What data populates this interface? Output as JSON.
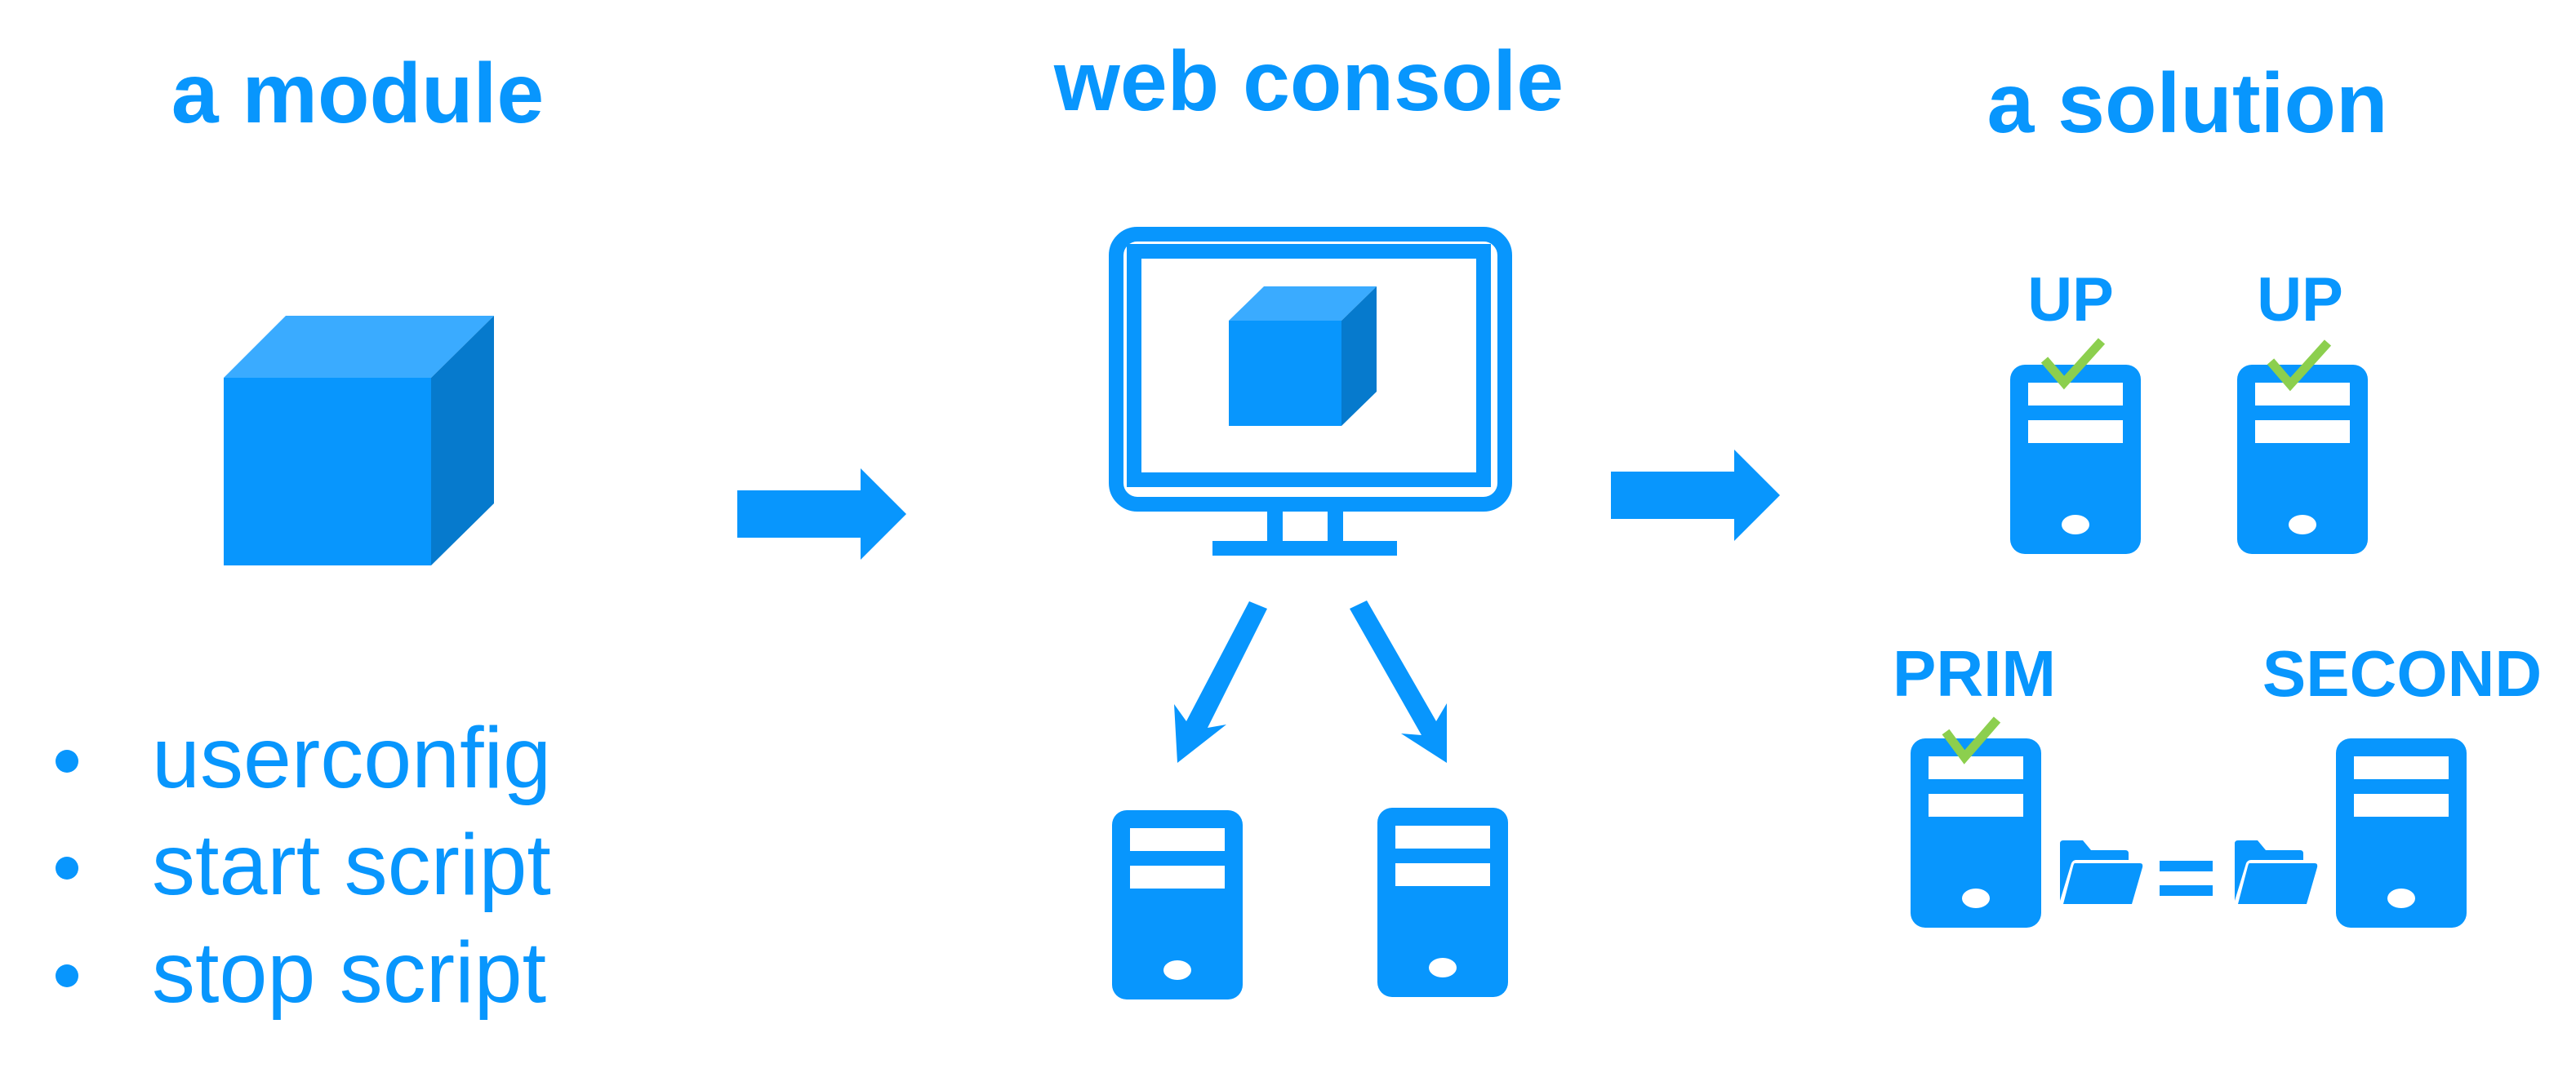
{
  "colors": {
    "primary": "#0896fd",
    "cube_top": "#3aabff",
    "cube_side": "#067acd",
    "check": "#8ccf4e",
    "background": "#ffffff"
  },
  "sections": {
    "module": {
      "title": "a module",
      "bullets": [
        "userconfig",
        "start script",
        "stop script"
      ]
    },
    "console": {
      "title": "web console"
    },
    "solution": {
      "title": "a solution",
      "up_servers": [
        {
          "label": "UP",
          "status": "ok"
        },
        {
          "label": "UP",
          "status": "ok"
        }
      ],
      "replication": {
        "primary_label": "PRIM",
        "primary_status": "ok",
        "secondary_label": "SECOND",
        "relation": "="
      }
    }
  },
  "icons": {
    "module_cube": "cube-icon",
    "monitor": "monitor-icon",
    "server": "server-icon",
    "check": "check-icon",
    "folder": "folder-icon",
    "arrow": "arrow-right-icon"
  }
}
